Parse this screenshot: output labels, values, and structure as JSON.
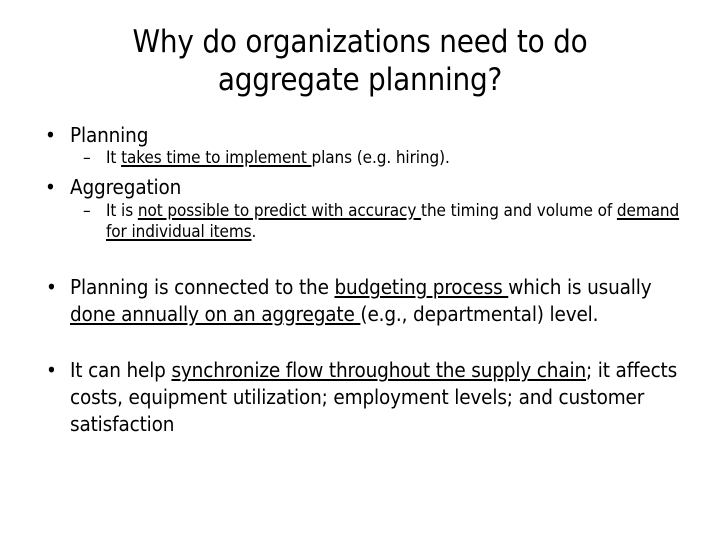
{
  "slide": {
    "title": "Why do organizations need to do\naggregate planning?",
    "background_color": "#ffffff",
    "text_color": "#000000",
    "bullet_glyph": "•",
    "dash_glyph": "–",
    "blocks": [
      {
        "id": "planning-heading",
        "level": 1,
        "text": "Planning"
      },
      {
        "id": "planning-detail",
        "level": 2,
        "segments": [
          {
            "text": "It ",
            "underline": false
          },
          {
            "text": "takes time to implement ",
            "underline": true
          },
          {
            "text": "plans (e.g. hiring).",
            "underline": false
          }
        ],
        "plain": "It takes time to implement plans (e.g. hiring)."
      },
      {
        "id": "aggregation-heading",
        "level": 1,
        "text": "Aggregation"
      },
      {
        "id": "aggregation-detail",
        "level": 2,
        "segments": [
          {
            "text": "It is ",
            "underline": false
          },
          {
            "text": "not possible to predict with accuracy ",
            "underline": true
          },
          {
            "text": "the timing and volume of ",
            "underline": false
          },
          {
            "text": "demand for individual items",
            "underline": true
          },
          {
            "text": ".",
            "underline": false
          }
        ],
        "plain": "It is not possible to predict with accuracy the timing and volume of demand for individual items."
      },
      {
        "id": "budgeting-paragraph",
        "level": 1,
        "segments": [
          {
            "text": "Planning is connected to the ",
            "underline": false
          },
          {
            "text": "budgeting process ",
            "underline": true
          },
          {
            "text": "which is usually ",
            "underline": false
          },
          {
            "text": "done annually on an aggregate ",
            "underline": true
          },
          {
            "text": "(e.g., departmental) level.",
            "underline": false
          }
        ],
        "plain": "Planning is connected to the budgeting process which is usually done annually on an aggregate (e.g., departmental) level."
      },
      {
        "id": "supply-chain-paragraph",
        "level": 1,
        "segments": [
          {
            "text": "It can help ",
            "underline": false
          },
          {
            "text": "synchronize flow throughout the supply chain",
            "underline": true
          },
          {
            "text": "; it affects costs, equipment utilization; employment levels; and customer satisfaction",
            "underline": false
          }
        ],
        "plain": "It can help synchronize flow throughout the supply chain; it affects costs, equipment utilization; employment levels; and customer satisfaction"
      }
    ]
  }
}
